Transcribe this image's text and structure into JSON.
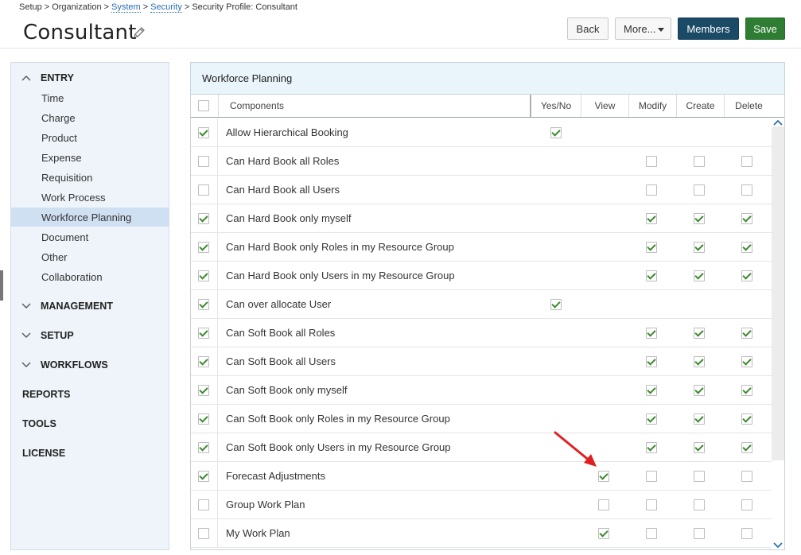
{
  "breadcrumb": {
    "setup": "Setup",
    "organization": "Organization",
    "system": "System",
    "security": "Security",
    "current": "Security Profile: Consultant",
    "separator": ">"
  },
  "page": {
    "title": "Consultant"
  },
  "buttons": {
    "back": "Back",
    "more": "More...",
    "members": "Members",
    "save": "Save"
  },
  "colors": {
    "members": "#1b4a66",
    "save": "#2e7d32",
    "check": "#3c8a2e",
    "active_nav": "#cfe0f2",
    "annotation_arrow": "#e02020"
  },
  "sidebar": {
    "entry": {
      "label": "ENTRY",
      "items": [
        "Time",
        "Charge",
        "Product",
        "Expense",
        "Requisition",
        "Work Process",
        "Workforce Planning",
        "Document",
        "Other",
        "Collaboration"
      ],
      "active": "Workforce Planning"
    },
    "groups": [
      "MANAGEMENT",
      "SETUP",
      "WORKFLOWS"
    ],
    "links": [
      "REPORTS",
      "TOOLS",
      "LICENSE"
    ]
  },
  "panel": {
    "title": "Workforce Planning",
    "columns": {
      "components": "Components",
      "yesno": "Yes/No",
      "view": "View",
      "modify": "Modify",
      "create": "Create",
      "delete": "Delete"
    },
    "rows": [
      {
        "name": "Allow Hierarchical Booking",
        "selected": true,
        "yesno": true,
        "view": null,
        "modify": null,
        "create": null,
        "delete": null
      },
      {
        "name": "Can Hard Book all Roles",
        "selected": false,
        "yesno": null,
        "view": null,
        "modify": false,
        "create": false,
        "delete": false
      },
      {
        "name": "Can Hard Book all Users",
        "selected": false,
        "yesno": null,
        "view": null,
        "modify": false,
        "create": false,
        "delete": false
      },
      {
        "name": "Can Hard Book only myself",
        "selected": true,
        "yesno": null,
        "view": null,
        "modify": true,
        "create": true,
        "delete": true
      },
      {
        "name": "Can Hard Book only Roles in my Resource Group",
        "selected": true,
        "yesno": null,
        "view": null,
        "modify": true,
        "create": true,
        "delete": true
      },
      {
        "name": "Can Hard Book only Users in my Resource Group",
        "selected": true,
        "yesno": null,
        "view": null,
        "modify": true,
        "create": true,
        "delete": true
      },
      {
        "name": "Can over allocate User",
        "selected": true,
        "yesno": true,
        "view": null,
        "modify": null,
        "create": null,
        "delete": null
      },
      {
        "name": "Can Soft Book all Roles",
        "selected": true,
        "yesno": null,
        "view": null,
        "modify": true,
        "create": true,
        "delete": true
      },
      {
        "name": "Can Soft Book all Users",
        "selected": true,
        "yesno": null,
        "view": null,
        "modify": true,
        "create": true,
        "delete": true
      },
      {
        "name": "Can Soft Book only myself",
        "selected": true,
        "yesno": null,
        "view": null,
        "modify": true,
        "create": true,
        "delete": true
      },
      {
        "name": "Can Soft Book only Roles in my Resource Group",
        "selected": true,
        "yesno": null,
        "view": null,
        "modify": true,
        "create": true,
        "delete": true
      },
      {
        "name": "Can Soft Book only Users in my Resource Group",
        "selected": true,
        "yesno": null,
        "view": null,
        "modify": true,
        "create": true,
        "delete": true
      },
      {
        "name": "Forecast Adjustments",
        "selected": true,
        "yesno": null,
        "view": true,
        "modify": false,
        "create": false,
        "delete": false
      },
      {
        "name": "Group Work Plan",
        "selected": false,
        "yesno": null,
        "view": false,
        "modify": false,
        "create": false,
        "delete": false
      },
      {
        "name": "My Work Plan",
        "selected": false,
        "yesno": null,
        "view": true,
        "modify": false,
        "create": false,
        "delete": false
      }
    ]
  },
  "icons": {
    "edit": "pencil-icon",
    "collapse": "chevron-up-icon",
    "expand": "chevron-down-icon",
    "dropdown": "caret-down-icon",
    "scroll_up": "scroll-up-icon",
    "scroll_down": "scroll-down-icon",
    "annotation": "red-arrow"
  }
}
